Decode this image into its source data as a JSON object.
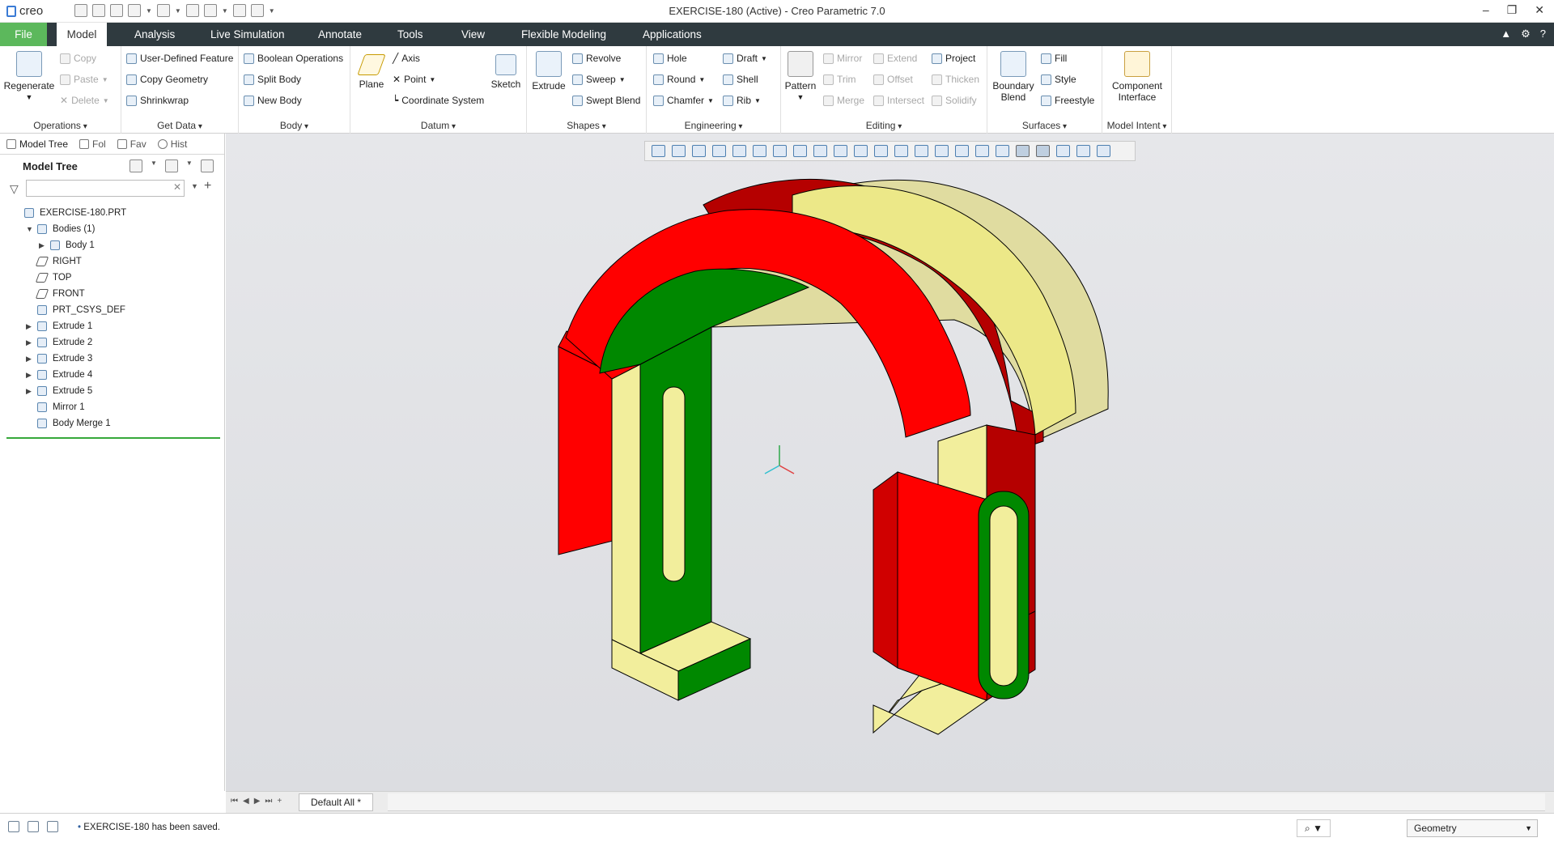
{
  "window": {
    "app_logo": "creo",
    "title": "EXERCISE-180 (Active) - Creo Parametric 7.0",
    "controls": [
      "–",
      "❐",
      "✕"
    ]
  },
  "tabs": [
    {
      "label": "File"
    },
    {
      "label": "Model"
    },
    {
      "label": "Analysis"
    },
    {
      "label": "Live Simulation"
    },
    {
      "label": "Annotate"
    },
    {
      "label": "Tools"
    },
    {
      "label": "View"
    },
    {
      "label": "Flexible Modeling"
    },
    {
      "label": "Applications"
    }
  ],
  "ribbon": {
    "operations": {
      "label": "Operations",
      "regenerate": "Regenerate",
      "copy": "Copy",
      "paste": "Paste",
      "delete": "Delete"
    },
    "get_data": {
      "label": "Get Data",
      "udf": "User-Defined Feature",
      "copy_geometry": "Copy Geometry",
      "shrinkwrap": "Shrinkwrap"
    },
    "body": {
      "label": "Body",
      "boolean": "Boolean Operations",
      "split": "Split Body",
      "new": "New Body"
    },
    "datum": {
      "label": "Datum",
      "plane": "Plane",
      "axis": "Axis",
      "point": "Point",
      "csys": "Coordinate System",
      "sketch": "Sketch"
    },
    "shapes": {
      "label": "Shapes",
      "extrude": "Extrude",
      "revolve": "Revolve",
      "sweep": "Sweep",
      "swept_blend": "Swept Blend"
    },
    "engineering": {
      "label": "Engineering",
      "hole": "Hole",
      "round": "Round",
      "chamfer": "Chamfer",
      "draft": "Draft",
      "shell": "Shell",
      "rib": "Rib"
    },
    "editing": {
      "label": "Editing",
      "pattern": "Pattern",
      "mirror": "Mirror",
      "trim": "Trim",
      "merge": "Merge",
      "extend": "Extend",
      "offset": "Offset",
      "intersect": "Intersect",
      "project": "Project",
      "thicken": "Thicken",
      "solidify": "Solidify"
    },
    "surfaces": {
      "label": "Surfaces",
      "boundary_blend_1": "Boundary",
      "boundary_blend_2": "Blend",
      "fill": "Fill",
      "style": "Style",
      "freestyle": "Freestyle"
    },
    "model_intent": {
      "label": "Model Intent",
      "component_interface_1": "Component",
      "component_interface_2": "Interface"
    }
  },
  "nav_tabs": [
    {
      "label": "Model Tree"
    },
    {
      "label": "Fol"
    },
    {
      "label": "Fav"
    },
    {
      "label": "Hist"
    }
  ],
  "model_tree": {
    "header": "Model Tree",
    "search_placeholder": "",
    "items": [
      {
        "label": "EXERCISE-180.PRT",
        "toggle": ""
      },
      {
        "label": "Bodies (1)",
        "toggle": "▼"
      },
      {
        "label": "Body 1",
        "toggle": "▶"
      },
      {
        "label": "RIGHT",
        "toggle": ""
      },
      {
        "label": "TOP",
        "toggle": ""
      },
      {
        "label": "FRONT",
        "toggle": ""
      },
      {
        "label": "PRT_CSYS_DEF",
        "toggle": ""
      },
      {
        "label": "Extrude 1",
        "toggle": "▶"
      },
      {
        "label": "Extrude 2",
        "toggle": "▶"
      },
      {
        "label": "Extrude 3",
        "toggle": "▶"
      },
      {
        "label": "Extrude 4",
        "toggle": "▶"
      },
      {
        "label": "Extrude 5",
        "toggle": "▶"
      },
      {
        "label": "Mirror 1",
        "toggle": ""
      },
      {
        "label": "Body Merge 1",
        "toggle": ""
      }
    ]
  },
  "window_tabs": {
    "active": "Default All *"
  },
  "status": {
    "message": "EXERCISE-180 has been saved.",
    "filter": "Geometry"
  },
  "colors": {
    "red": "#ff0000",
    "dark_red": "#b50000",
    "green": "#008800",
    "yellow": "#f2ee9c",
    "ribbon_dark": "#2f3a3f",
    "file_tab": "#5cb85c"
  }
}
